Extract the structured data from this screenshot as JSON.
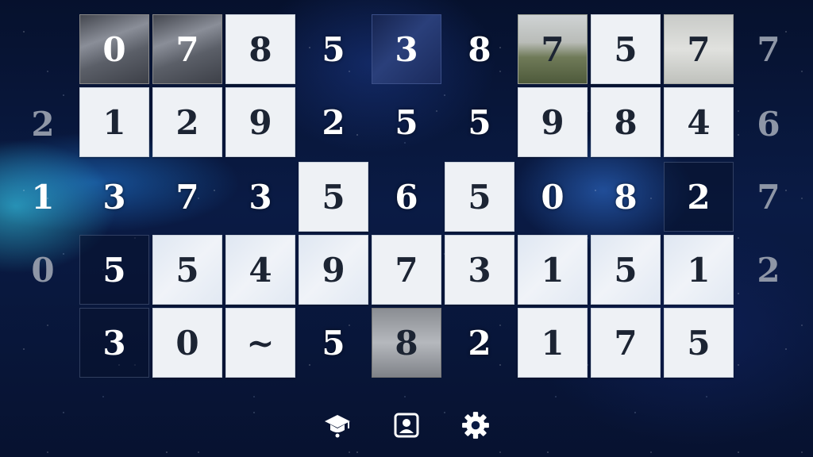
{
  "board": {
    "rows": [
      [
        "0",
        "7",
        "8",
        "5",
        "3",
        "8",
        "7",
        "5",
        "7"
      ],
      [
        "1",
        "2",
        "9",
        "2",
        "5",
        "5",
        "9",
        "8",
        "4"
      ],
      [
        "3",
        "7",
        "3",
        "5",
        "6",
        "5",
        "0",
        "8",
        "2"
      ],
      [
        "5",
        "5",
        "4",
        "9",
        "7",
        "3",
        "1",
        "5",
        "1"
      ],
      [
        "3",
        "0",
        "~",
        "5",
        "8",
        "2",
        "1",
        "7",
        "5"
      ]
    ]
  },
  "left_hints": [
    "",
    "2",
    "1",
    "0",
    ""
  ],
  "right_hints": [
    "7",
    "6",
    "7",
    "2",
    ""
  ],
  "nav": {
    "learn_icon": "graduation-cap-icon",
    "profile_icon": "profile-card-icon",
    "settings_icon": "gear-icon"
  }
}
